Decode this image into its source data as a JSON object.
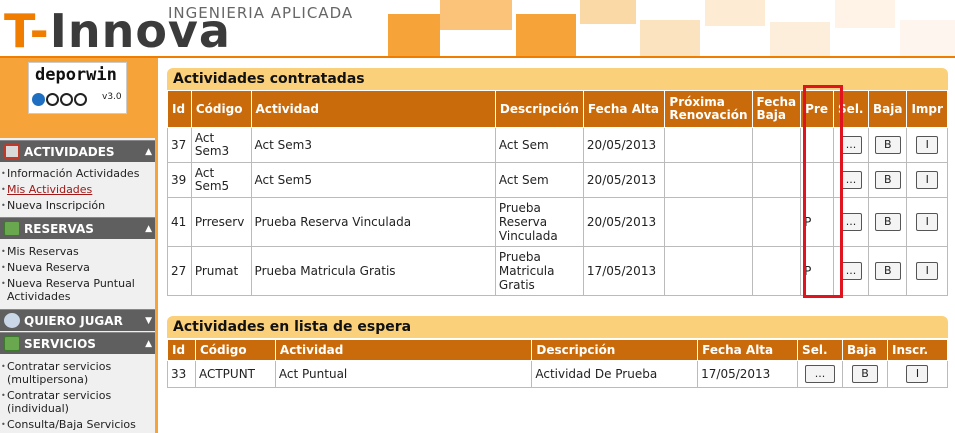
{
  "header": {
    "logo_t": "T-",
    "logo_rest": "Innova",
    "subtitle": "INGENIERIA APLICADA"
  },
  "brand": {
    "name": "deporwin",
    "version": "v3.0"
  },
  "sidebar": {
    "sections": [
      {
        "title": "ACTIVIDADES",
        "items": [
          "Información Actividades",
          "Mis Actividades",
          "Nueva Inscripción"
        ]
      },
      {
        "title": "RESERVAS",
        "items": [
          "Mis Reservas",
          "Nueva Reserva",
          "Nueva Reserva Puntual Actividades"
        ]
      },
      {
        "title": "QUIERO JUGAR",
        "items": []
      },
      {
        "title": "SERVICIOS",
        "items": [
          "Contratar servicios (multipersona)",
          "Contratar servicios (individual)",
          "Consulta/Baja Servicios"
        ]
      }
    ]
  },
  "contracted": {
    "title": "Actividades contratadas",
    "headers": [
      "Id",
      "Código",
      "Actividad",
      "Descripción",
      "Fecha Alta",
      "Próxima Renovación",
      "Fecha Baja",
      "Pre",
      "Sel.",
      "Baja",
      "Impr"
    ],
    "rows": [
      {
        "id": "37",
        "codigo": "Act Sem3",
        "actividad": "Act Sem3",
        "descripcion": "Act Sem",
        "fecha_alta": "20/05/2013",
        "renovacion": "",
        "fecha_baja": "",
        "pre": ""
      },
      {
        "id": "39",
        "codigo": "Act Sem5",
        "actividad": "Act Sem5",
        "descripcion": "Act Sem",
        "fecha_alta": "20/05/2013",
        "renovacion": "",
        "fecha_baja": "",
        "pre": ""
      },
      {
        "id": "41",
        "codigo": "Prreserv",
        "actividad": "Prueba Reserva Vinculada",
        "descripcion": "Prueba Reserva Vinculada",
        "fecha_alta": "20/05/2013",
        "renovacion": "",
        "fecha_baja": "",
        "pre": "P"
      },
      {
        "id": "27",
        "codigo": "Prumat",
        "actividad": "Prueba Matricula Gratis",
        "descripcion": "Prueba Matricula Gratis",
        "fecha_alta": "17/05/2013",
        "renovacion": "",
        "fecha_baja": "",
        "pre": "P"
      }
    ],
    "btn_sel": "...",
    "btn_baja": "B",
    "btn_impr": "I"
  },
  "waitlist": {
    "title": "Actividades en lista de espera",
    "headers": [
      "Id",
      "Código",
      "Actividad",
      "Descripción",
      "Fecha Alta",
      "Sel.",
      "Baja",
      "Inscr."
    ],
    "rows": [
      {
        "id": "33",
        "codigo": "ACTPUNT",
        "actividad": "Act Puntual",
        "descripcion": "Actividad De Prueba",
        "fecha_alta": "17/05/2013"
      }
    ],
    "btn_sel": "...",
    "btn_baja": "B",
    "btn_inscr": "I"
  },
  "colors": {
    "accent": "#f07d00",
    "table_header": "#c96a0b",
    "highlight": "#e0141e"
  }
}
